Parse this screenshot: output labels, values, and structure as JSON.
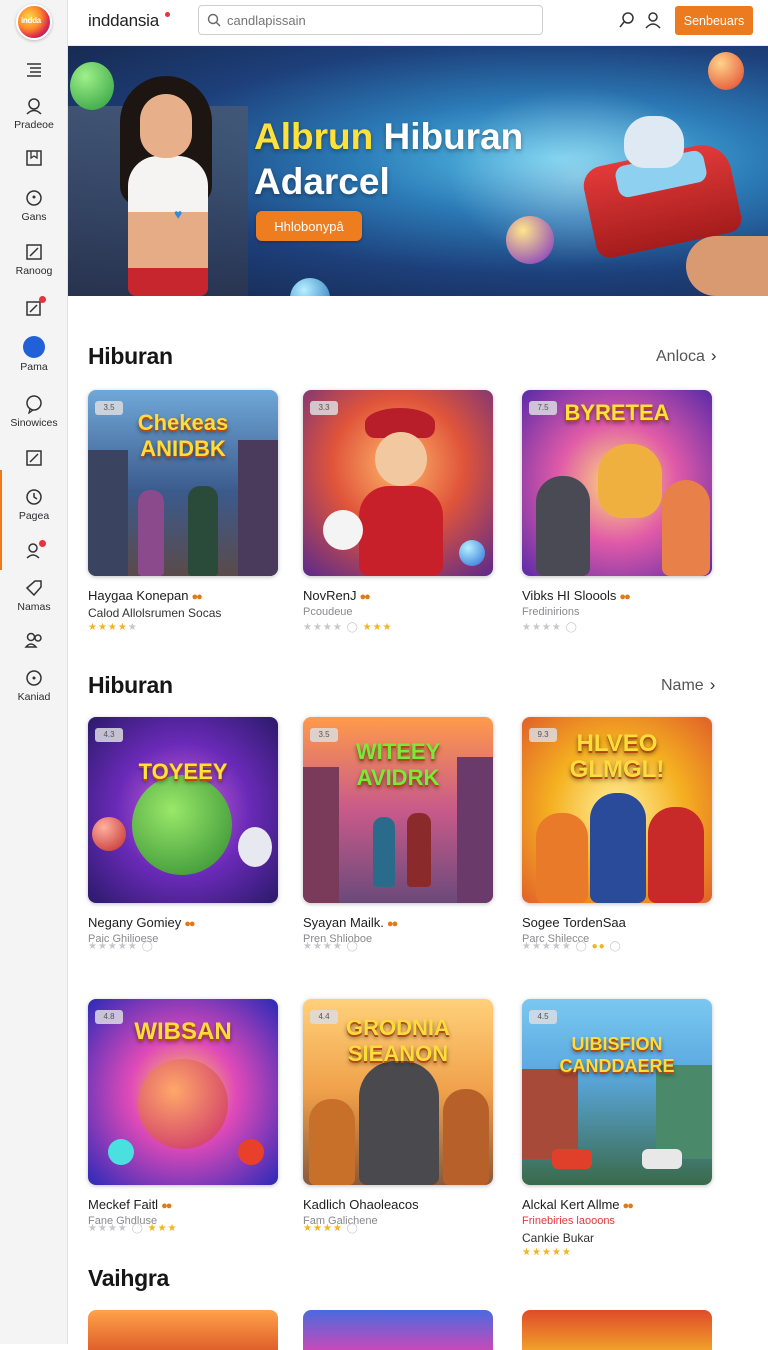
{
  "app": {
    "logo_text": "indda",
    "brand": "inddansia",
    "search_placeholder": "candlapissain",
    "cta_label": "Senbeuars"
  },
  "sidebar": {
    "items": [
      {
        "icon": "menu-list-icon",
        "label": ""
      },
      {
        "icon": "profile-icon",
        "label": "Pradeoe"
      },
      {
        "icon": "bookmark-box-icon",
        "label": ""
      },
      {
        "icon": "chat-bubble-icon",
        "label": "Gans"
      },
      {
        "icon": "edit-square-icon",
        "label": "Ranoog"
      },
      {
        "icon": "notification-edit-icon",
        "label": ""
      },
      {
        "icon": "globe-icon",
        "label": "Pama"
      },
      {
        "icon": "message-icon",
        "label": "Sinowices"
      },
      {
        "icon": "square-pen-icon",
        "label": ""
      },
      {
        "icon": "clock-icon",
        "label": "Pagea"
      },
      {
        "icon": "user-alert-icon",
        "label": ""
      },
      {
        "icon": "tag-icon",
        "label": "Namas"
      },
      {
        "icon": "group-icon",
        "label": ""
      },
      {
        "icon": "search-circle-icon",
        "label": "Kaniad"
      }
    ]
  },
  "hero": {
    "title_highlight": "Albrun",
    "title_rest": " Hiburan",
    "title_line2": "Adarcel",
    "button_label": "Hhlobonypâ"
  },
  "sections": [
    {
      "title": "Hiburan",
      "link": "Anloca",
      "cards": [
        {
          "badge": "3.5",
          "art": "Chekeas ANIDBK",
          "name": "Haygaa Konepan",
          "sub": "Calod Allolsrumen Socas",
          "rating": 4
        },
        {
          "badge": "3.3",
          "art": "",
          "name": "NovRenJ",
          "sub": "Pcoudeue",
          "rating": 3
        },
        {
          "badge": "7.5",
          "art": "BYRETEA",
          "name": "Vibks HI Sloools",
          "sub": "Fredinirions",
          "rating": 0
        }
      ]
    },
    {
      "title": "Hiburan",
      "link": "Name",
      "cards": [
        {
          "badge": "4.3",
          "art": "TOYEEY",
          "name": "Negany Gomiey",
          "sub": "Paic Ghilioese",
          "rating": 0
        },
        {
          "badge": "3.5",
          "art": "WITEEY AVIDRK",
          "name": "Syayan Mailk.",
          "sub": "Pren Shlioboe",
          "rating": 0
        },
        {
          "badge": "9.3",
          "art": "HLVEO GLMGL!",
          "name": "Sogee TordenSaa",
          "sub": "Parc Shilecce",
          "rating": 3
        }
      ]
    },
    {
      "title": "",
      "link": "",
      "cards": [
        {
          "badge": "4.8",
          "art": "WIBSAN",
          "name": "Meckef Faitl",
          "sub": "Fane Ghdluse",
          "rating": 3
        },
        {
          "badge": "4.4",
          "art": "GRODNIA SIEANON",
          "name": "Kadlich Ohaoleacos",
          "sub": "Fam Galichene",
          "rating": 4
        },
        {
          "badge": "4.5",
          "art": "UIBISFION CANDDAERE",
          "name": "Alckal Kert Allme",
          "sub": "Frinebiries laooons",
          "sub2": "Cankie Bukar",
          "rating": 5
        }
      ]
    },
    {
      "title": "Vaihgra",
      "link": "",
      "cards": []
    }
  ]
}
